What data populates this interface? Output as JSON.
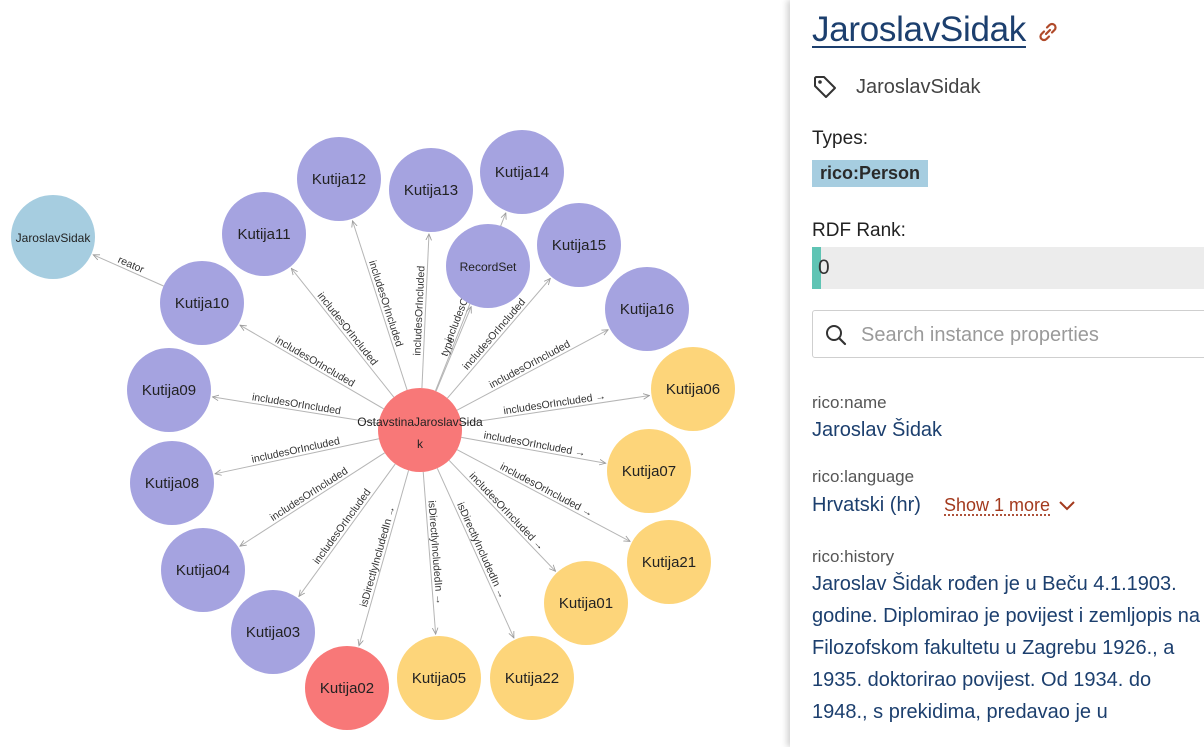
{
  "graph": {
    "nodes": [
      {
        "id": "center",
        "label": "OstavstinaJaroslavSida k",
        "color": "#f87878"
      },
      {
        "id": "jaroslav",
        "label": "JaroslavSidak",
        "color": "#a6cde0"
      },
      {
        "id": "recordset",
        "label": "RecordSet",
        "color": "#a5a3e0"
      },
      {
        "id": "k10",
        "label": "Kutija10",
        "color": "#a5a3e0"
      },
      {
        "id": "k11",
        "label": "Kutija11",
        "color": "#a5a3e0"
      },
      {
        "id": "k12",
        "label": "Kutija12",
        "color": "#a5a3e0"
      },
      {
        "id": "k13",
        "label": "Kutija13",
        "color": "#a5a3e0"
      },
      {
        "id": "k14",
        "label": "Kutija14",
        "color": "#a5a3e0"
      },
      {
        "id": "k15",
        "label": "Kutija15",
        "color": "#a5a3e0"
      },
      {
        "id": "k16",
        "label": "Kutija16",
        "color": "#a5a3e0"
      },
      {
        "id": "k09",
        "label": "Kutija09",
        "color": "#a5a3e0"
      },
      {
        "id": "k08",
        "label": "Kutija08",
        "color": "#a5a3e0"
      },
      {
        "id": "k04",
        "label": "Kutija04",
        "color": "#a5a3e0"
      },
      {
        "id": "k03",
        "label": "Kutija03",
        "color": "#a5a3e0"
      },
      {
        "id": "k02",
        "label": "Kutija02",
        "color": "#f87878"
      },
      {
        "id": "k05",
        "label": "Kutija05",
        "color": "#fdd57a"
      },
      {
        "id": "k22",
        "label": "Kutija22",
        "color": "#fdd57a"
      },
      {
        "id": "k01",
        "label": "Kutija01",
        "color": "#fdd57a"
      },
      {
        "id": "k21",
        "label": "Kutija21",
        "color": "#fdd57a"
      },
      {
        "id": "k07",
        "label": "Kutija07",
        "color": "#fdd57a"
      },
      {
        "id": "k06",
        "label": "Kutija06",
        "color": "#fdd57a"
      }
    ],
    "edges": [
      {
        "from": "k10",
        "to": "jaroslav",
        "label": "reator"
      },
      {
        "from": "center",
        "to": "k10",
        "label": "includesOrIncluded"
      },
      {
        "from": "center",
        "to": "k11",
        "label": "includesOrIncluded"
      },
      {
        "from": "center",
        "to": "k12",
        "label": "includesOrIncluded"
      },
      {
        "from": "center",
        "to": "k13",
        "label": "includesOrIncluded"
      },
      {
        "from": "center",
        "to": "k14",
        "label": "includesOrIncluded"
      },
      {
        "from": "center",
        "to": "recordset",
        "label": "type"
      },
      {
        "from": "center",
        "to": "k15",
        "label": "includesOrIncluded"
      },
      {
        "from": "center",
        "to": "k16",
        "label": "includesOrIncluded"
      },
      {
        "from": "center",
        "to": "k09",
        "label": "includesOrIncluded"
      },
      {
        "from": "center",
        "to": "k08",
        "label": "includesOrIncluded"
      },
      {
        "from": "center",
        "to": "k04",
        "label": "includesOrIncluded"
      },
      {
        "from": "center",
        "to": "k03",
        "label": "includesOrIncluded"
      },
      {
        "from": "center",
        "to": "k02",
        "label": "isDirectlyIncludedIn →"
      },
      {
        "from": "center",
        "to": "k05",
        "label": "isDirectlyIncludedIn →"
      },
      {
        "from": "center",
        "to": "k22",
        "label": "isDirectlyIncludedIn →"
      },
      {
        "from": "center",
        "to": "k01",
        "label": "includesOrIncluded →"
      },
      {
        "from": "center",
        "to": "k21",
        "label": "includesOrIncluded →"
      },
      {
        "from": "center",
        "to": "k07",
        "label": "includesOrIncluded →"
      },
      {
        "from": "center",
        "to": "k06",
        "label": "includesOrIncluded →"
      }
    ]
  },
  "panel": {
    "title": "JaroslavSidak",
    "label": "JaroslavSidak",
    "types_heading": "Types:",
    "type_badge": "rico:Person",
    "rdf_rank_heading": "RDF Rank:",
    "rdf_rank_value": "0",
    "rdf_rank_fraction": 0,
    "search_placeholder": "Search instance properties",
    "properties": {
      "name_key": "rico:name",
      "name_value": "Jaroslav Šidak",
      "language_key": "rico:language",
      "language_value": "Hrvatski (hr)",
      "show_more": "Show 1 more",
      "history_key": "rico:history",
      "history_value": "Jaroslav Šidak rođen je u Beču 4.1.1903. godine. Diplomirao je povijest i zemljopis na Filozofskom fakultetu u Zagrebu 1926., a 1935. doktorirao povijest. Od 1934. do 1948., s prekidima, predavao je u"
    },
    "colors": {
      "title": "#1c3f6e",
      "badge": "#a6cde0",
      "rank_fill": "#5fc4b4",
      "show_more": "#a33a1e"
    }
  }
}
